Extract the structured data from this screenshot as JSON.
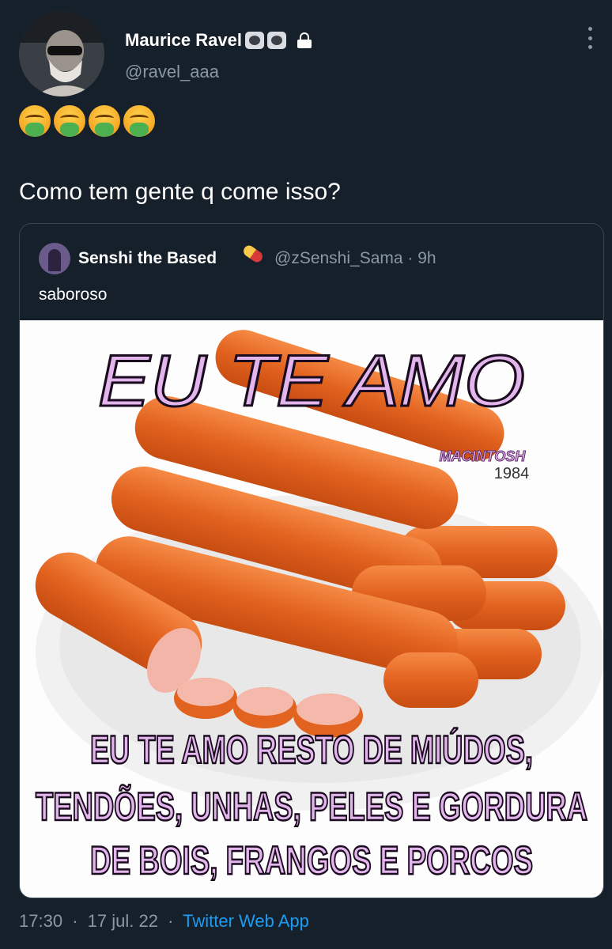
{
  "author": {
    "display_name": "Maurice Ravel",
    "handle": "@ravel_aaa",
    "badges": [
      "skull-badge-icon",
      "skull-badge-icon"
    ],
    "protected_icon": "lock-icon"
  },
  "tweet": {
    "emojis": [
      "nauseated-face-emoji",
      "nauseated-face-emoji",
      "nauseated-face-emoji",
      "nauseated-face-emoji"
    ],
    "text": "Como tem gente q come isso?"
  },
  "quoted": {
    "display_name": "Senshi the Based",
    "handle_time": "@zSenshi_Sama · 9h",
    "text": "saboroso",
    "image": {
      "top_text": "EU TE AMO",
      "watermark_brand": "MACINTOSH",
      "watermark_year": "1984",
      "bottom_lines": [
        "EU TE AMO RESTO DE MIÚDOS,",
        "TENDÕES, UNHAS, PELES E GORDURA",
        "DE BOIS, FRANGOS E PORCOS"
      ]
    }
  },
  "meta": {
    "time": "17:30",
    "date": "17 jul. 22",
    "separator": "·",
    "source": "Twitter Web App"
  },
  "colors": {
    "background": "#15202b",
    "secondary_text": "#8b98a5",
    "link": "#1d9bf0",
    "meme_text_fill": "#e2b6ec",
    "sausage": "#e86a2a"
  }
}
